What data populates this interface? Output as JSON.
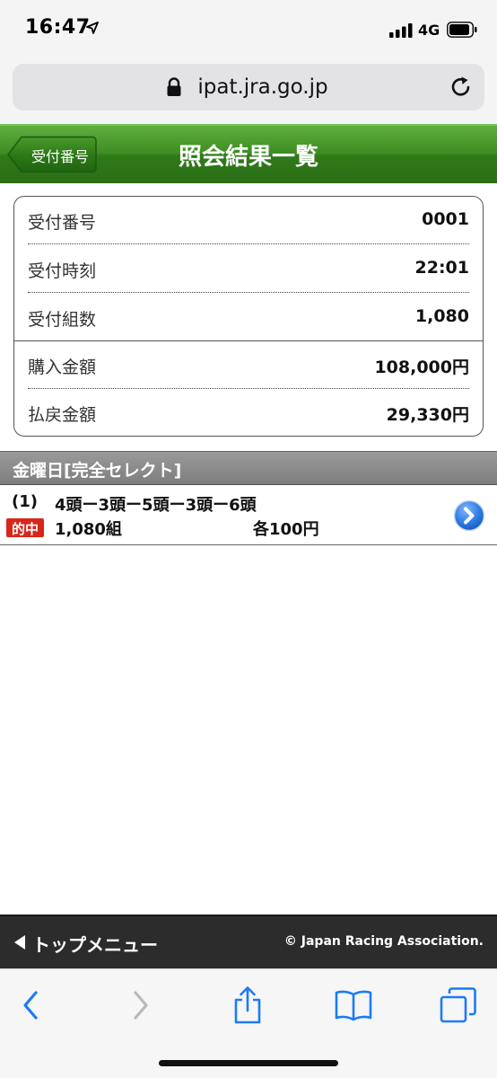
{
  "status_bar": {
    "time": "16:47",
    "network": "4G",
    "icons": [
      "location-arrow-icon",
      "signal-icon",
      "battery-icon"
    ]
  },
  "browser": {
    "url": "ipat.jra.go.jp",
    "icons": [
      "lock-icon",
      "reload-icon"
    ]
  },
  "header": {
    "back_label": "受付番号",
    "title": "照会結果一覧",
    "color": "#3d8d23"
  },
  "summary": {
    "rows": [
      {
        "label": "受付番号",
        "value": "0001"
      },
      {
        "label": "受付時刻",
        "value": "22:01"
      },
      {
        "label": "受付組数",
        "value": "1,080"
      },
      {
        "label": "購入金額",
        "value": "108,000円"
      },
      {
        "label": "払戻金額",
        "value": "29,330円"
      }
    ]
  },
  "section": {
    "title": "金曜日[完全セレクト]"
  },
  "bets": [
    {
      "number": "(1)",
      "combination": "4頭ー3頭ー5頭ー3頭ー6頭",
      "badge": "的中",
      "count": "1,080組",
      "unit": "各100円",
      "badge_color": "#d8261a"
    }
  ],
  "footer": {
    "top_menu": "トップメニュー",
    "copyright": "© Japan Racing Association."
  },
  "toolbar": {
    "icons": [
      "back-arrow-icon",
      "forward-arrow-icon",
      "share-icon",
      "bookmarks-icon",
      "tabs-icon"
    ],
    "accent": "#1a7cf5"
  }
}
